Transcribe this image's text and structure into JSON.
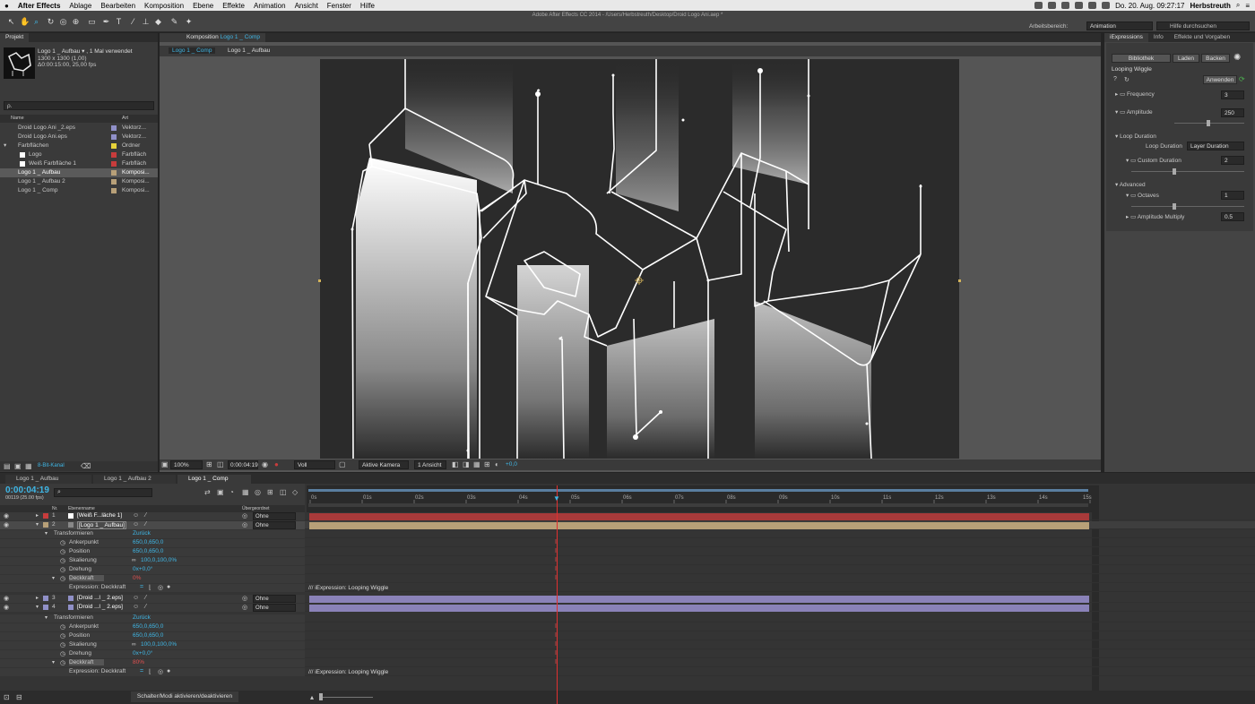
{
  "menubar": {
    "app": "After Effects",
    "items": [
      "Ablage",
      "Bearbeiten",
      "Komposition",
      "Ebene",
      "Effekte",
      "Animation",
      "Ansicht",
      "Fenster",
      "Hilfe"
    ],
    "datetime": "Do. 20. Aug.  09:27:17",
    "user": "Herbstreuth"
  },
  "window": {
    "title": "Adobe After Effects CC 2014 - /Users/Herbstreuth/Desktop/Droid Logo Ani.aep *"
  },
  "workspace": {
    "label": "Arbeitsbereich:",
    "value": "Animation",
    "search_placeholder": "Hilfe durchsuchen"
  },
  "project": {
    "tab": "Projekt",
    "item_name": "Logo 1 _ Aufbau ▾ , 1 Mal verwendet",
    "item_size": "1300 x 1300 (1,00)",
    "item_duration": "Δ0:00:15:00, 25,00 fps",
    "search_placeholder": "ρ.",
    "col_name": "Name",
    "col_type": "Art",
    "items": [
      {
        "name": "Droid Logo Ani _2.eps",
        "type": "Vektorz...",
        "color": "#9090c8"
      },
      {
        "name": "Droid Logo Ani.eps",
        "type": "Vektorz...",
        "color": "#9090c8"
      },
      {
        "name": "Farbflächen",
        "type": "Ordner",
        "color": "#e6d23a"
      },
      {
        "name": "Logo",
        "type": "Farbfläch",
        "color": "#c83c3c"
      },
      {
        "name": "Weiß Farbfläche 1",
        "type": "Farbfläch",
        "color": "#c83c3c"
      },
      {
        "name": "Logo 1 _ Aufbau",
        "type": "Komposi...",
        "color": "#b8a078"
      },
      {
        "name": "Logo 1 _ Aufbau 2",
        "type": "Komposi...",
        "color": "#b8a078"
      },
      {
        "name": "Logo 1 _ Comp",
        "type": "Komposi...",
        "color": "#b8a078"
      }
    ],
    "footer_bits": "8-Bit-Kanal"
  },
  "comp": {
    "tab_prefix": "Komposition",
    "tab_name": "Logo 1 _ Comp",
    "crumb1": "Logo 1 _ Comp",
    "crumb2": "Logo 1 _ Aufbau",
    "zoom": "100%",
    "time": "0:00:04:19",
    "resolution": "Voll",
    "camera": "Aktive Kamera",
    "views": "1 Ansicht",
    "exposure": "+0,0"
  },
  "effects": {
    "tabs": [
      "iExpressions",
      "Info",
      "Effekte und Vorgaben"
    ],
    "buttons": [
      "Bibliothek",
      "Laden",
      "Backen"
    ],
    "preset": "Looping Wiggle",
    "apply": "Anwenden",
    "params": [
      {
        "label": "Frequency",
        "value": "3"
      },
      {
        "label": "Amplitude",
        "value": "250"
      }
    ],
    "loop_section": "Loop Duration",
    "loop_label": "Loop Duration",
    "loop_value": "Layer Duration",
    "custom_label": "Custom Duration",
    "custom_value": "2",
    "advanced": "Advanced",
    "octaves_label": "Octaves",
    "octaves_value": "1",
    "ampmult_label": "Amplitude Multiply",
    "ampmult_value": "0.5"
  },
  "timeline": {
    "tabs": [
      "Logo 1 _ Aufbau",
      "Logo 1 _ Aufbau 2",
      "Logo 1 _ Comp"
    ],
    "timecode": "0:00:04:19",
    "frames": "00119 (25.00 fps)",
    "col_nr": "Nr.",
    "col_layer": "Ebenenname",
    "col_parent": "Übergeordnet",
    "ticks": [
      "0s",
      "01s",
      "02s",
      "03s",
      "04s",
      "05s",
      "06s",
      "07s",
      "08s",
      "09s",
      "10s",
      "11s",
      "12s",
      "13s",
      "14s",
      "15s"
    ],
    "layers": [
      {
        "nr": "1",
        "name": "[Weiß F...läche 1]",
        "parent": "Ohne",
        "color": "#c83c3c"
      },
      {
        "nr": "2",
        "name": "[Logo 1 _ Aufbau]",
        "parent": "Ohne",
        "color": "#b8a078"
      },
      {
        "nr": "3",
        "name": "[Droid ...l _ 2.eps]",
        "parent": "Ohne",
        "color": "#9090c8"
      },
      {
        "nr": "4",
        "name": "[Droid ...l _ 2.eps]",
        "parent": "Ohne",
        "color": "#9090c8"
      }
    ],
    "transform": "Transformieren",
    "reset": "Zurück",
    "props": [
      {
        "label": "Ankerpunkt",
        "value": "650,0,650,0"
      },
      {
        "label": "Position",
        "value": "650,0,650,0"
      },
      {
        "label": "Skalierung",
        "value": "100,0,100,0%"
      },
      {
        "label": "Drehung",
        "value": "0x+0,0°"
      },
      {
        "label": "Deckkraft",
        "value": "0%"
      }
    ],
    "props2_opacity": "80%",
    "expression_label": "Expression: Deckkraft",
    "expression_text": "/// iExpression: Looping Wiggle",
    "footer": "Schalter/Modi aktivieren/deaktivieren"
  }
}
